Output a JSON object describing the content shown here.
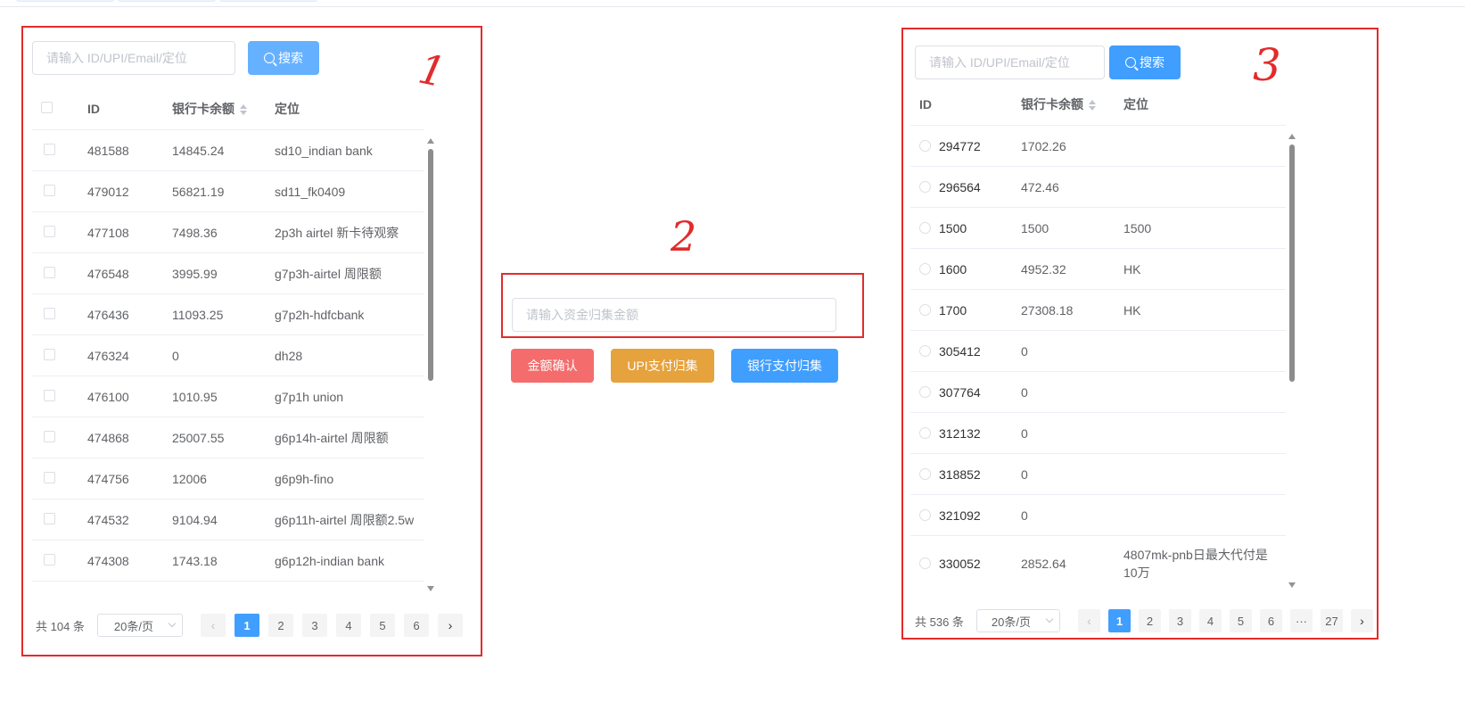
{
  "annotations": {
    "mark1": "1",
    "mark2": "2",
    "mark3": "3"
  },
  "colors": {
    "primary": "#409eff",
    "primary_light": "#66b1ff",
    "danger": "#f56c6c",
    "warning": "#e6a23c",
    "frame": "#e32b2b"
  },
  "panel1": {
    "search_placeholder": "请输入 ID/UPI/Email/定位",
    "search_button": "搜索",
    "search_icon": "search-icon",
    "columns": [
      "ID",
      "银行卡余额",
      "定位"
    ],
    "rows": [
      {
        "id": "481588",
        "balance": "14845.24",
        "location": "sd10_indian bank"
      },
      {
        "id": "479012",
        "balance": "56821.19",
        "location": "sd11_fk0409"
      },
      {
        "id": "477108",
        "balance": "7498.36",
        "location": "2p3h airtel 新卡待观察"
      },
      {
        "id": "476548",
        "balance": "3995.99",
        "location": "g7p3h-airtel 周限额"
      },
      {
        "id": "476436",
        "balance": "11093.25",
        "location": "g7p2h-hdfcbank"
      },
      {
        "id": "476324",
        "balance": "0",
        "location": "dh28"
      },
      {
        "id": "476100",
        "balance": "1010.95",
        "location": "g7p1h union"
      },
      {
        "id": "474868",
        "balance": "25007.55",
        "location": "g6p14h-airtel 周限额"
      },
      {
        "id": "474756",
        "balance": "12006",
        "location": "g6p9h-fino"
      },
      {
        "id": "474532",
        "balance": "9104.94",
        "location": "g6p11h-airtel 周限额2.5w"
      },
      {
        "id": "474308",
        "balance": "1743.18",
        "location": "g6p12h-indian bank"
      }
    ],
    "pagination": {
      "total": "共 104 条",
      "page_size": "20条/页",
      "pages": [
        "1",
        "2",
        "3",
        "4",
        "5",
        "6"
      ],
      "current": "1",
      "prev": "‹",
      "next": "›"
    }
  },
  "panel2": {
    "amount_placeholder": "请输入资金归集金额",
    "buttons": {
      "confirm": "金额确认",
      "upi": "UPI支付归集",
      "bank": "银行支付归集"
    }
  },
  "panel3": {
    "search_placeholder": "请输入 ID/UPI/Email/定位",
    "search_button": "搜索",
    "search_icon": "search-icon",
    "columns": [
      "ID",
      "银行卡余额",
      "定位"
    ],
    "rows": [
      {
        "id": "294772",
        "balance": "1702.26",
        "location": ""
      },
      {
        "id": "296564",
        "balance": "472.46",
        "location": ""
      },
      {
        "id": "1500",
        "balance": "1500",
        "location": "1500"
      },
      {
        "id": "1600",
        "balance": "4952.32",
        "location": "HK"
      },
      {
        "id": "1700",
        "balance": "27308.18",
        "location": "HK"
      },
      {
        "id": "305412",
        "balance": "0",
        "location": ""
      },
      {
        "id": "307764",
        "balance": "0",
        "location": ""
      },
      {
        "id": "312132",
        "balance": "0",
        "location": ""
      },
      {
        "id": "318852",
        "balance": "0",
        "location": ""
      },
      {
        "id": "321092",
        "balance": "0",
        "location": ""
      },
      {
        "id": "330052",
        "balance": "2852.64",
        "location": "4807mk-pnb日最大代付是10万"
      }
    ],
    "pagination": {
      "total": "共 536 条",
      "page_size": "20条/页",
      "pages": [
        "1",
        "2",
        "3",
        "4",
        "5",
        "6",
        "···",
        "27"
      ],
      "current": "1",
      "prev": "‹",
      "next": "›"
    }
  }
}
